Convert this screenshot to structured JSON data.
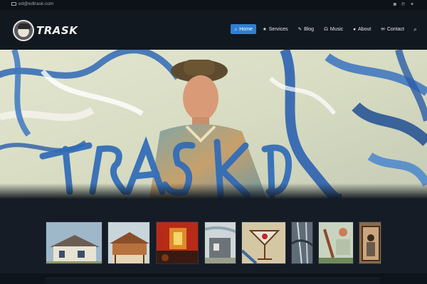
{
  "topbar": {
    "email": "ed@edtrask.com",
    "social_icons": [
      "instagram-icon",
      "pinterest-icon",
      "twitter-icon"
    ]
  },
  "brand": {
    "name": "TRASK"
  },
  "nav": {
    "items": [
      {
        "label": "Home",
        "icon": "home-icon",
        "active": true
      },
      {
        "label": "Services",
        "icon": "star-icon",
        "active": false
      },
      {
        "label": "Blog",
        "icon": "pencil-icon",
        "active": false
      },
      {
        "label": "Music",
        "icon": "headphones-icon",
        "active": false
      },
      {
        "label": "About",
        "icon": "user-icon",
        "active": false
      },
      {
        "label": "Contact",
        "icon": "envelope-icon",
        "active": false
      }
    ],
    "search_icon": "search-icon"
  },
  "hero": {
    "painted_text": "TRASK ED"
  },
  "gallery": {
    "thumbnails": [
      "painting-1",
      "painting-2",
      "painting-3",
      "painting-4",
      "painting-5",
      "painting-6",
      "painting-7",
      "painting-8"
    ]
  },
  "colors": {
    "accent": "#2f7fd0",
    "background": "#0f151c",
    "header": "#111820"
  }
}
